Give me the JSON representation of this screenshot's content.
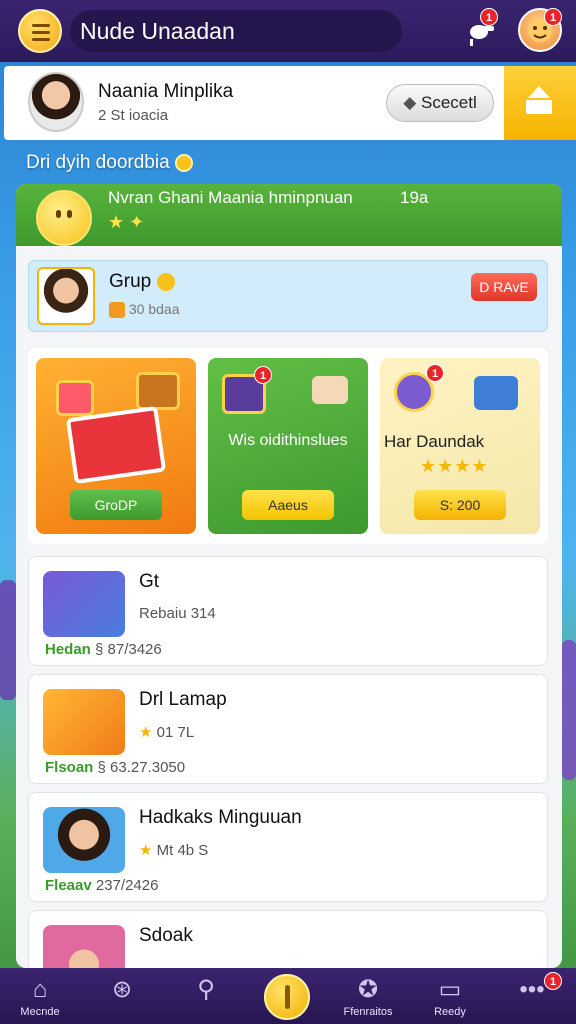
{
  "header": {
    "title": "Nude Unaadan",
    "notification_badge": "1",
    "avatar_badge": "1",
    "menu_icon": "hamburger-icon",
    "bell_icon": "whistle-icon"
  },
  "profile": {
    "name": "Naania Minplika",
    "subtitle": "2 St ioacia",
    "select_label": "Scecetl",
    "tab_icon": "upload-icon"
  },
  "section": {
    "label": "Dri dyih doordbia"
  },
  "panel": {
    "title": "Nvran Ghani Maania hminpnuan",
    "count": "19a"
  },
  "group": {
    "title": "Grup",
    "subtitle": "30 bdaa",
    "button": "D RAvE"
  },
  "cards": [
    {
      "label": "",
      "button": "GroDP"
    },
    {
      "label": "Wis oidithinslues",
      "button": "Aaeus",
      "badge": "1"
    },
    {
      "label": "Har Daundak",
      "stars": "★★★★",
      "button": "S: 200",
      "badge": "1"
    }
  ],
  "list": [
    {
      "title": "Gt",
      "meta": "Rebaiu  314",
      "foot_name": "Hedan",
      "foot_value": "§ 87/3426"
    },
    {
      "title": "Drl  Lamap",
      "meta": "01 7L",
      "foot_name": "Flsoan",
      "foot_value": "§ 63.27.3050"
    },
    {
      "title": "Hadkaks Minguuan",
      "meta": "Mt 4b  S",
      "foot_name": "Fleaav",
      "foot_value": "237/2426"
    },
    {
      "title": "Sdoak",
      "meta": "",
      "foot_name": "",
      "foot_value": ""
    }
  ],
  "nav": [
    {
      "label": "Mecnde",
      "icon": "home-icon"
    },
    {
      "label": "",
      "icon": "search-person-icon"
    },
    {
      "label": "",
      "icon": "search-icon"
    },
    {
      "label": "",
      "icon": "coin-icon"
    },
    {
      "label": "Ffenraitos",
      "icon": "star-search-icon"
    },
    {
      "label": "Reedy",
      "icon": "monitor-icon"
    },
    {
      "label": "",
      "icon": "more-icon",
      "badge": "1"
    }
  ]
}
